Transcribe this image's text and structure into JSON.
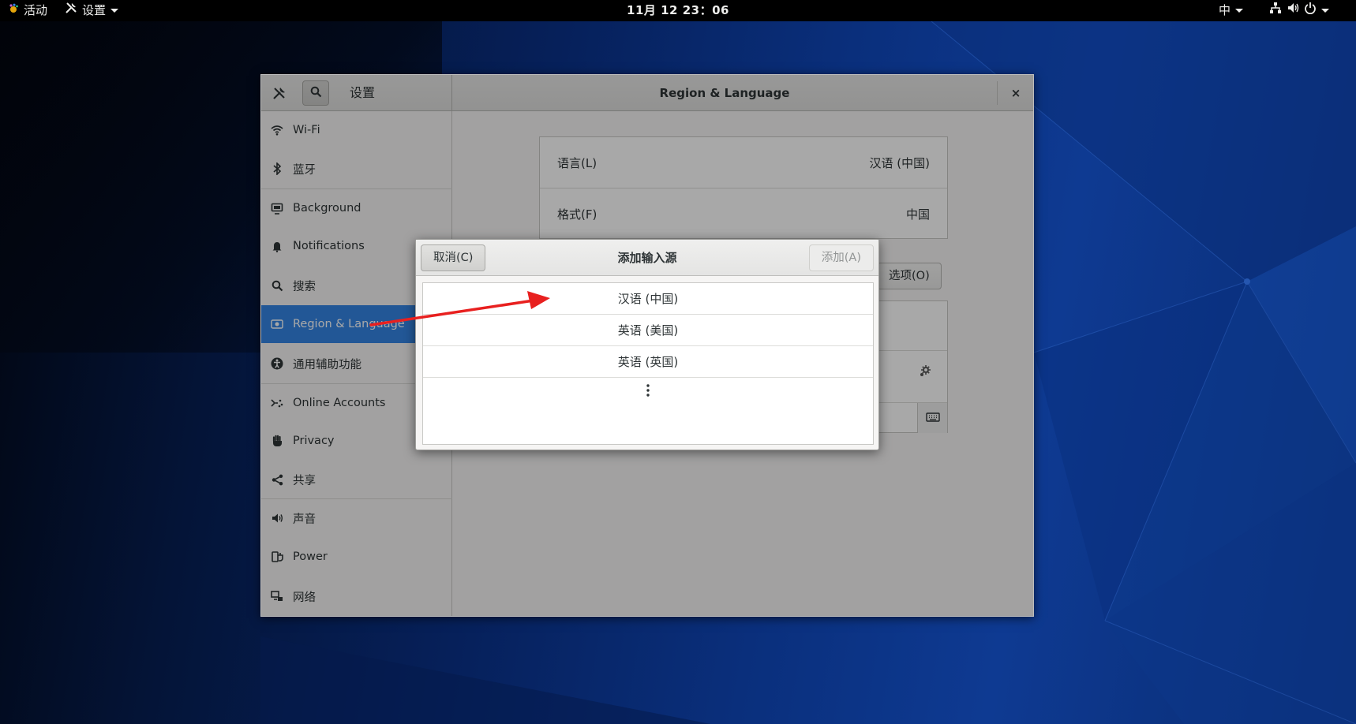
{
  "topbar": {
    "activities": "活动",
    "app_menu": "设置",
    "clock": "11月 12  23：06",
    "input_method": "中"
  },
  "window": {
    "sidebar_title": "设置",
    "title": "Region & Language",
    "close_label": "×"
  },
  "sidebar": {
    "items": [
      {
        "label": "Wi-Fi",
        "icon": "wifi-icon"
      },
      {
        "label": "蓝牙",
        "icon": "bluetooth-icon"
      },
      {
        "label": "Background",
        "icon": "background-icon"
      },
      {
        "label": "Notifications",
        "icon": "bell-icon"
      },
      {
        "label": "搜索",
        "icon": "search-icon"
      },
      {
        "label": "Region & Language",
        "icon": "region-icon",
        "active": true
      },
      {
        "label": "通用辅助功能",
        "icon": "accessibility-icon"
      },
      {
        "label": "Online Accounts",
        "icon": "online-accounts-icon"
      },
      {
        "label": "Privacy",
        "icon": "hand-icon"
      },
      {
        "label": "共享",
        "icon": "share-icon"
      },
      {
        "label": "声音",
        "icon": "speaker-icon"
      },
      {
        "label": "Power",
        "icon": "power-plug-icon"
      },
      {
        "label": "网络",
        "icon": "network-icon"
      }
    ]
  },
  "region": {
    "language_label": "语言(L)",
    "language_value": "汉语 (中国)",
    "formats_label": "格式(F)",
    "formats_value": "中国",
    "options_label": "选项(O)"
  },
  "dialog": {
    "title": "添加输入源",
    "cancel_label": "取消(C)",
    "add_label": "添加(A)",
    "languages": [
      "汉语 (中国)",
      "英语 (美国)",
      "英语 (英国)"
    ],
    "more_symbol": "⋮"
  },
  "colors": {
    "accent": "#3584e4",
    "annotation_arrow": "#e8201f"
  }
}
